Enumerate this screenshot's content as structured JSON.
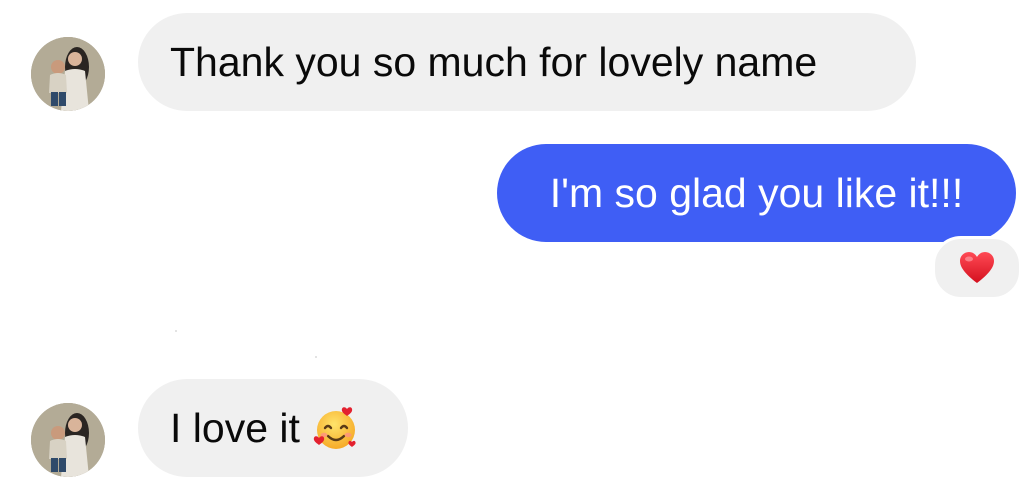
{
  "conversation": {
    "messages": [
      {
        "direction": "incoming",
        "text": "Thank you so much for lovely name"
      },
      {
        "direction": "outgoing",
        "text": "I'm so glad you like it!!!",
        "reaction": "heart-icon"
      },
      {
        "direction": "incoming",
        "text": "I love it",
        "emoji": "smiling-face-with-hearts-icon"
      }
    ]
  },
  "colors": {
    "incoming_bubble": "#f0f0f0",
    "outgoing_bubble": "#3f5ef5",
    "outgoing_text": "#ffffff",
    "reaction_heart": "#e0202d"
  }
}
